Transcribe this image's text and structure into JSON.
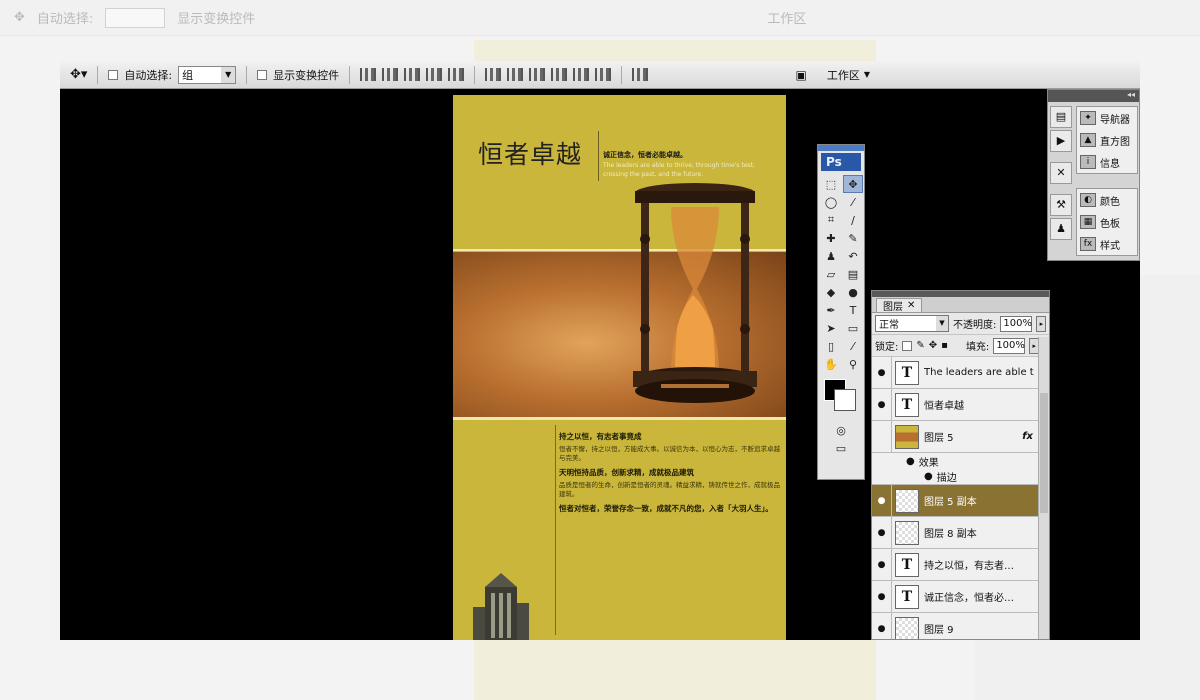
{
  "options_bar": {
    "auto_select_label": "自动选择:",
    "auto_select_value": "组",
    "show_transform_label": "显示变换控件",
    "workspace_label": "工作区"
  },
  "document": {
    "title": "恒者卓越",
    "slogan": "诚正信念，恒者必能卓越。",
    "english": "The leaders are able to thrive, through time's test, crossing the past, and the future.",
    "heading1": "持之以恒，有志者事竟成",
    "para1": "恒者不懈，持之以恒，方能成大事。以诚信为本，以恒心为志，不断追求卓越与完美。",
    "heading2": "天明恒持品质，创新求精，成就极品建筑",
    "para2": "品质是恒者的生命，创新是恒者的灵魂。精益求精，铸就传世之作，成就极品建筑。",
    "closing": "恒者对恒者，荣誉存念一致，成就不凡的您，入者「大羽人生」。"
  },
  "toolbox": {
    "logo": "Ps"
  },
  "dock": {
    "items": [
      {
        "label": "导航器",
        "icon": "navigator-icon"
      },
      {
        "label": "直方图",
        "icon": "histogram-icon"
      },
      {
        "label": "信息",
        "icon": "info-icon"
      },
      {
        "label": "颜色",
        "icon": "color-icon"
      },
      {
        "label": "色板",
        "icon": "swatches-icon"
      },
      {
        "label": "样式",
        "icon": "styles-icon"
      }
    ]
  },
  "layers_panel": {
    "tab_label": "图层",
    "blend_mode": "正常",
    "opacity_label": "不透明度:",
    "opacity_value": "100%",
    "lock_label": "锁定:",
    "fill_label": "填充:",
    "fill_value": "100%",
    "effects_label": "效果",
    "stroke_label": "描边",
    "fx_label": "fx",
    "layers": [
      {
        "name": "The leaders are able t…",
        "type": "text",
        "thumb": "T"
      },
      {
        "name": "恒者卓越",
        "type": "text",
        "thumb": "T"
      },
      {
        "name": "图层 5",
        "type": "image",
        "thumb": ""
      },
      {
        "name": "图层 5 副本",
        "type": "pixel",
        "thumb": ""
      },
      {
        "name": "图层 8 副本",
        "type": "pixel",
        "thumb": ""
      },
      {
        "name": "持之以恒，有志者…",
        "type": "text",
        "thumb": "T"
      },
      {
        "name": "诚正信念，恒者必…",
        "type": "text",
        "thumb": "T"
      },
      {
        "name": "图层 9",
        "type": "pixel",
        "thumb": ""
      }
    ]
  }
}
